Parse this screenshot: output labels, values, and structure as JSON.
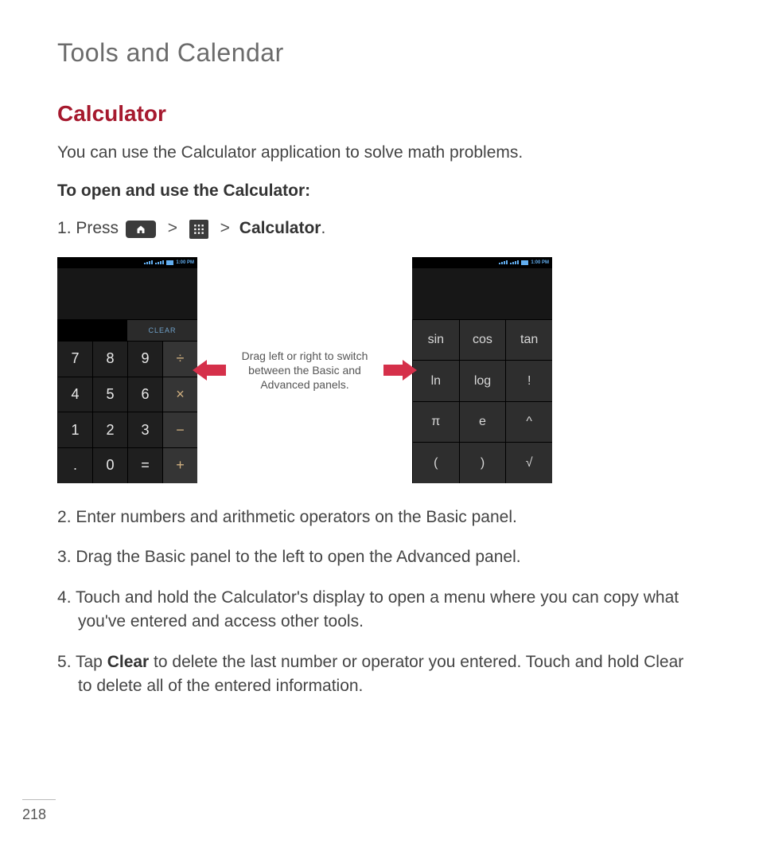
{
  "chapter_title": "Tools and Calendar",
  "section_title": "Calculator",
  "intro": "You can use the Calculator application to solve math problems.",
  "subhead": "To open and use the Calculator:",
  "step1_a": "Press ",
  "step1_b": "Calculator",
  "step1_c": ".",
  "hint_text": "Drag left or right  to switch between the Basic and Advanced panels.",
  "step2": "Enter numbers and arithmetic operators on the Basic panel.",
  "step3": "Drag the Basic panel to the left to open the Advanced panel.",
  "step4": "Touch and hold the Calculator's display to open a menu where you can copy what you've entered and access other tools.",
  "step5_a": "Tap ",
  "step5_b": "Clear",
  "step5_c": " to delete the last number or operator you entered. Touch and hold Clear to delete all of the entered information.",
  "page_number": "218",
  "phones": {
    "status_time": "1:00 PM",
    "clear_label": "CLEAR",
    "basic_keys": [
      "7",
      "8",
      "9",
      "÷",
      "4",
      "5",
      "6",
      "×",
      "1",
      "2",
      "3",
      "−",
      ".",
      "0",
      "=",
      "+"
    ],
    "basic_ops_idx": [
      3,
      7,
      11,
      15
    ],
    "adv_keys": [
      "sin",
      "cos",
      "tan",
      "ln",
      "log",
      "!",
      "π",
      "e",
      "^",
      "(",
      ")",
      "√"
    ]
  }
}
